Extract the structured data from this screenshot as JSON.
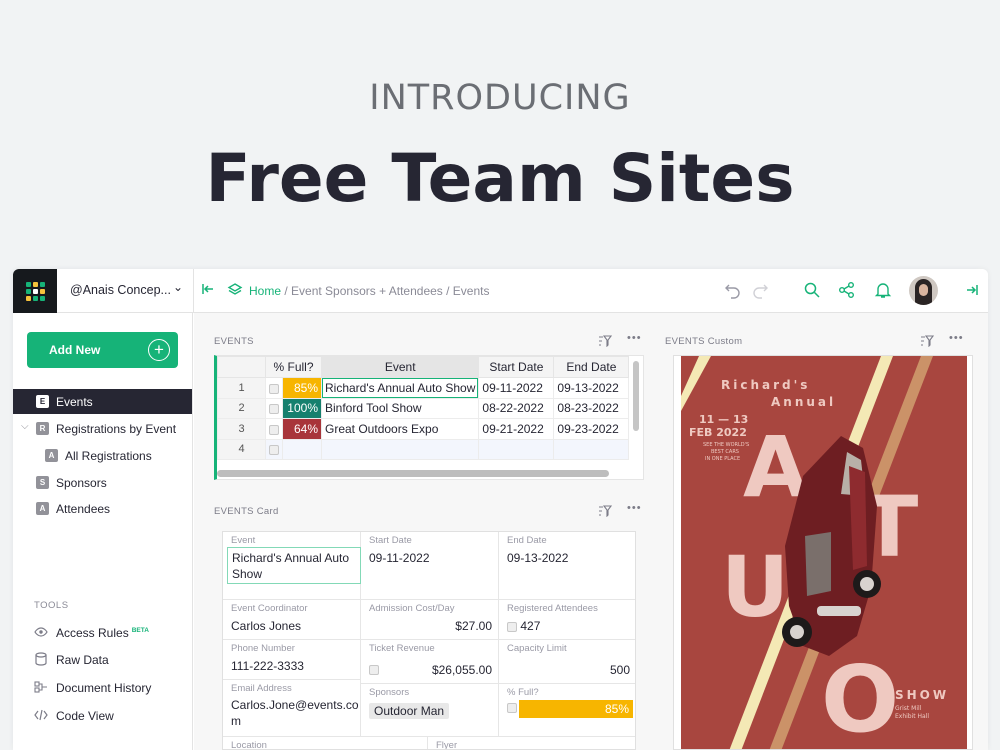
{
  "hero": {
    "kicker": "INTRODUCING",
    "title": "Free Team Sites"
  },
  "topbar": {
    "org": "@Anais Concep...",
    "breadcrumb": {
      "home": "Home",
      "rest": " / Event Sponsors + Attendees / Events"
    }
  },
  "sidebar": {
    "add_new": "Add New",
    "items": [
      {
        "badge": "E",
        "label": "Events"
      },
      {
        "badge": "R",
        "label": "Registrations by Event"
      },
      {
        "badge": "A",
        "label": "All Registrations"
      },
      {
        "badge": "S",
        "label": "Sponsors"
      },
      {
        "badge": "A",
        "label": "Attendees"
      }
    ],
    "tools_label": "TOOLS",
    "tools": [
      {
        "icon": "eye-icon",
        "label": "Access Rules",
        "badge": "BETA"
      },
      {
        "icon": "database-icon",
        "label": "Raw Data"
      },
      {
        "icon": "history-icon",
        "label": "Document History"
      },
      {
        "icon": "code-icon",
        "label": "Code View"
      }
    ]
  },
  "events_grid": {
    "title": "EVENTS",
    "columns": [
      "% Full?",
      "Event",
      "Start Date",
      "End Date"
    ],
    "rows": [
      {
        "num": "1",
        "pct": "85%",
        "pct_color": "#f7b500",
        "event": "Richard's Annual Auto Show",
        "start": "09-11-2022",
        "end": "09-13-2022"
      },
      {
        "num": "2",
        "pct": "100%",
        "pct_color": "#16806e",
        "event": "Binford Tool Show",
        "start": "08-22-2022",
        "end": "08-23-2022"
      },
      {
        "num": "3",
        "pct": "64%",
        "pct_color": "#a8353a",
        "event": "Great Outdoors Expo",
        "start": "09-21-2022",
        "end": "09-23-2022"
      },
      {
        "num": "4",
        "pct": "",
        "pct_color": "",
        "event": "",
        "start": "",
        "end": ""
      }
    ]
  },
  "events_card": {
    "title": "EVENTS Card",
    "event_label": "Event",
    "event_value": "Richard's Annual Auto Show",
    "start_label": "Start Date",
    "start_value": "09-11-2022",
    "end_label": "End Date",
    "end_value": "09-13-2022",
    "coordinator_label": "Event Coordinator",
    "coordinator_value": "Carlos Jones",
    "admission_label": "Admission Cost/Day",
    "admission_value": "$27.00",
    "registered_label": "Registered Attendees",
    "registered_value": "427",
    "phone_label": "Phone Number",
    "phone_value": "111-222-3333",
    "revenue_label": "Ticket Revenue",
    "revenue_value": "$26,055.00",
    "capacity_label": "Capacity Limit",
    "capacity_value": "500",
    "email_label": "Email Address",
    "email_value": "Carlos.Jone@events.co m",
    "sponsors_label": "Sponsors",
    "sponsors_value": "Outdoor Man",
    "full_label": "% Full?",
    "full_value": "85%",
    "location_label": "Location",
    "flyer_label": "Flyer"
  },
  "events_custom": {
    "title": "EVENTS Custom",
    "poster": {
      "line1": "Richard's",
      "line2": "Annual",
      "dates": "11 — 13",
      "month": "FEB 2022",
      "tagline1": "SEE THE WORLD'S",
      "tagline2": "BEST CARS",
      "tagline3": "IN ONE PLACE",
      "letters": [
        "A",
        "T",
        "U",
        "O"
      ],
      "show": "SHOW",
      "venue1": "Grist Mill",
      "venue2": "Exhibit Hall",
      "bg": "#a8463f",
      "stripe": "#f4e9b5",
      "letter_color": "#efc9c1"
    }
  },
  "colors": {
    "accent": "#16b378",
    "dark": "#262633"
  }
}
